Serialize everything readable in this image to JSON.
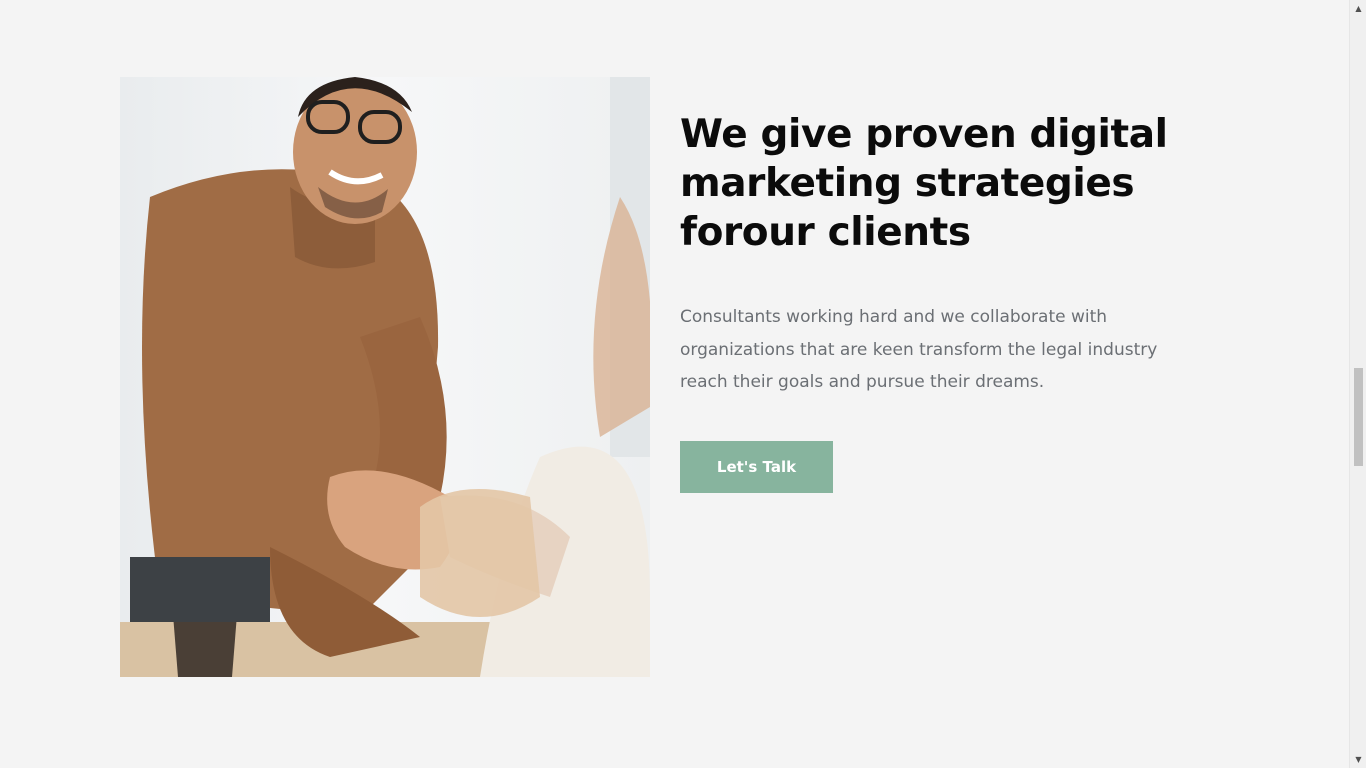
{
  "section": {
    "headline": "We give proven digital marketing strategies forour clients",
    "body": "Consultants working hard and we collaborate with organizations that are keen transform the legal industry reach their goals and pursue their dreams.",
    "cta_label": "Let's Talk"
  },
  "colors": {
    "background": "#f4f4f4",
    "headline": "#0b0b0b",
    "body_text": "#6b6f74",
    "accent": "#87b49e"
  },
  "icons": {
    "scroll_up": "scroll-up-arrow-icon",
    "scroll_down": "scroll-down-arrow-icon"
  }
}
